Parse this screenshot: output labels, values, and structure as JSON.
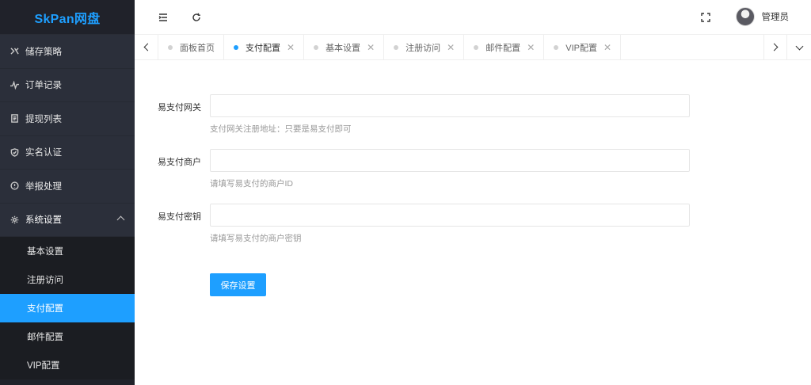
{
  "app": {
    "logo": "SkPan网盘"
  },
  "sidebar": {
    "items": [
      {
        "label": "储存策略",
        "icon": "storage-icon"
      },
      {
        "label": "订单记录",
        "icon": "pulse-icon"
      },
      {
        "label": "提现列表",
        "icon": "list-icon"
      },
      {
        "label": "实名认证",
        "icon": "shield-icon"
      },
      {
        "label": "举报处理",
        "icon": "info-icon"
      },
      {
        "label": "系统设置",
        "icon": "gear-icon"
      }
    ],
    "submenu": [
      {
        "label": "基本设置"
      },
      {
        "label": "注册访问"
      },
      {
        "label": "支付配置"
      },
      {
        "label": "邮件配置"
      },
      {
        "label": "VIP配置"
      }
    ],
    "active_sub": "支付配置",
    "accent": "#1e9fff"
  },
  "header": {
    "user_name": "管理员"
  },
  "tabs": {
    "items": [
      {
        "label": "面板首页"
      },
      {
        "label": "支付配置"
      },
      {
        "label": "基本设置"
      },
      {
        "label": "注册访问"
      },
      {
        "label": "邮件配置"
      },
      {
        "label": "VIP配置"
      }
    ],
    "active": "支付配置"
  },
  "form": {
    "gateway": {
      "label": "易支付网关",
      "value": "",
      "tip": "支付网关注册地址：只要是易支付即可"
    },
    "merchant": {
      "label": "易支付商户",
      "value": "",
      "tip": "请填写易支付的商户ID"
    },
    "secret": {
      "label": "易支付密钥",
      "value": "",
      "tip": "请填写易支付的商户密钥"
    },
    "save_label": "保存设置"
  }
}
